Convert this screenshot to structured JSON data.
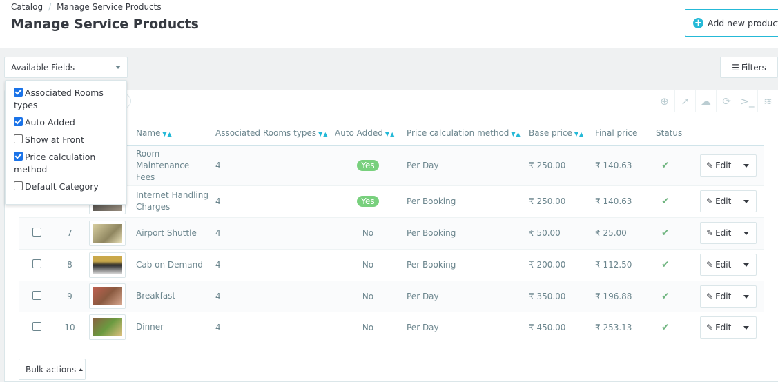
{
  "breadcrumb": {
    "parent": "Catalog",
    "separator": "/",
    "current": "Manage Service Products"
  },
  "page_title": "Manage Service Products",
  "add_button": {
    "label": "Add new product",
    "icon": "plus-circle-icon"
  },
  "available_fields": {
    "label": "Available Fields",
    "options": [
      {
        "label": "Associated Rooms types",
        "checked": true
      },
      {
        "label": "Auto Added",
        "checked": true
      },
      {
        "label": "Show at Front",
        "checked": false
      },
      {
        "label": "Price calculation method",
        "checked": true
      },
      {
        "label": "Default Category",
        "checked": false
      }
    ]
  },
  "filters_button": {
    "label": "Filters",
    "icon": "sliders-icon"
  },
  "panel": {
    "count": "6"
  },
  "toolbar": [
    {
      "name": "add-icon",
      "glyph": "⊕"
    },
    {
      "name": "export-icon",
      "glyph": "↗"
    },
    {
      "name": "cloud-upload-icon",
      "glyph": "☁"
    },
    {
      "name": "refresh-icon",
      "glyph": "⟳"
    },
    {
      "name": "terminal-icon",
      "glyph": ">_"
    },
    {
      "name": "database-icon",
      "glyph": "≋"
    }
  ],
  "columns": {
    "name": "Name",
    "assoc": "Associated Rooms types",
    "auto": "Auto Added",
    "method": "Price calculation method",
    "base": "Base price",
    "final": "Final price",
    "status": "Status"
  },
  "rows": [
    {
      "id": "",
      "name": "Room Maintenance Fees",
      "assoc": "4",
      "auto": "Yes",
      "method": "Per Day",
      "base": "₹ 250.00",
      "final": "₹ 140.63",
      "edit": "Edit"
    },
    {
      "id": "",
      "name": "Internet Handling Charges",
      "assoc": "4",
      "auto": "Yes",
      "method": "Per Booking",
      "base": "₹ 250.00",
      "final": "₹ 140.63",
      "edit": "Edit"
    },
    {
      "id": "7",
      "name": "Airport Shuttle",
      "assoc": "4",
      "auto": "No",
      "method": "Per Booking",
      "base": "₹ 50.00",
      "final": "₹ 25.00",
      "edit": "Edit"
    },
    {
      "id": "8",
      "name": "Cab on Demand",
      "assoc": "4",
      "auto": "No",
      "method": "Per Booking",
      "base": "₹ 200.00",
      "final": "₹ 112.50",
      "edit": "Edit"
    },
    {
      "id": "9",
      "name": "Breakfast",
      "assoc": "4",
      "auto": "No",
      "method": "Per Day",
      "base": "₹ 350.00",
      "final": "₹ 196.88",
      "edit": "Edit"
    },
    {
      "id": "10",
      "name": "Dinner",
      "assoc": "4",
      "auto": "No",
      "method": "Per Day",
      "base": "₹ 450.00",
      "final": "₹ 253.13",
      "edit": "Edit"
    }
  ],
  "bulk_actions": {
    "label": "Bulk actions"
  },
  "colors": {
    "accent": "#25b9d7",
    "yes_badge": "#78d07d",
    "status_ok": "#70b580"
  }
}
